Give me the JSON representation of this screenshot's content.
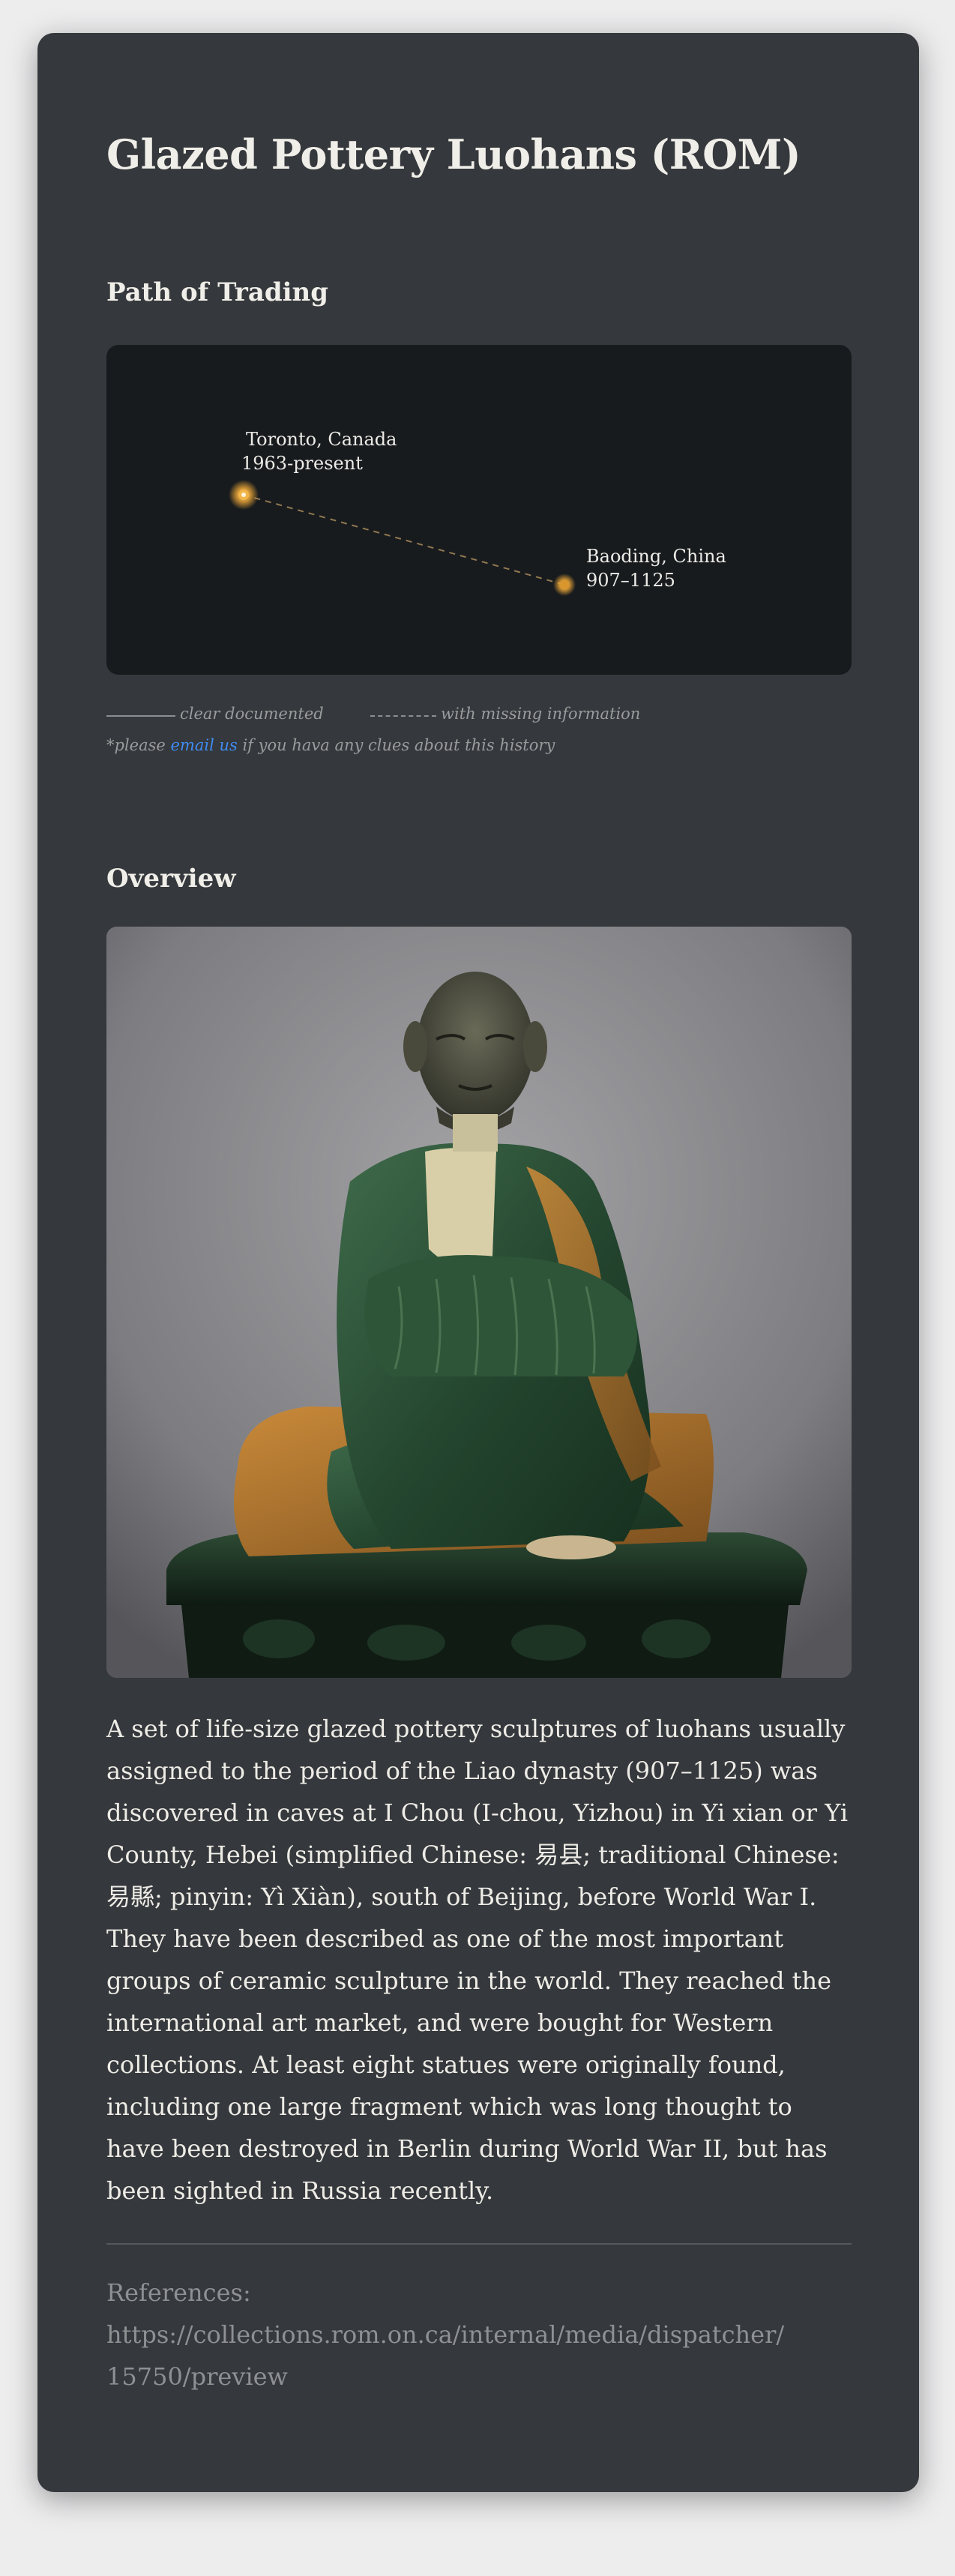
{
  "title": "Glazed Pottery Luohans (ROM)",
  "path_section": {
    "heading": "Path of Trading",
    "locations": [
      {
        "place": "Toronto, Canada",
        "period": "1963-present"
      },
      {
        "place": "Baoding, China",
        "period": "907–1125"
      }
    ],
    "marker_color": "#e8a437",
    "route_color": "#a68a5a"
  },
  "legend": {
    "clear": "clear documented",
    "missing": "with missing information",
    "note_prefix": "*please",
    "email_link": "email us",
    "note_suffix": "if you hava any clues about this history",
    "link_color": "#3f8cf2"
  },
  "overview": {
    "heading": "Overview",
    "image_icon": "luohan-statue-photo",
    "description": "A set of life-size glazed pottery sculptures of luohans usually assigned to the period of the Liao dynasty (907–1125) was discovered in caves at I Chou (I-chou, Yizhou) in Yi xian or Yi County, Hebei (simplified Chinese: 易县; traditional Chinese: 易縣; pinyin: Yì Xiàn), south of Beijing, before World War I. They have been described as one of the most important groups of ceramic sculpture in the world. They reached the international art market, and were bought for Western collections. At least eight statues were originally found, including one large fragment which was long thought to have been destroyed in Berlin during World War II, but has been sighted in Russia recently."
  },
  "references": {
    "label": "References:",
    "url": "https://collections.rom.on.ca/internal/media/dispatcher/15750/preview"
  },
  "colors": {
    "card_background": "#35383c",
    "map_background": "#181b1e",
    "page_background": "#ededee"
  }
}
